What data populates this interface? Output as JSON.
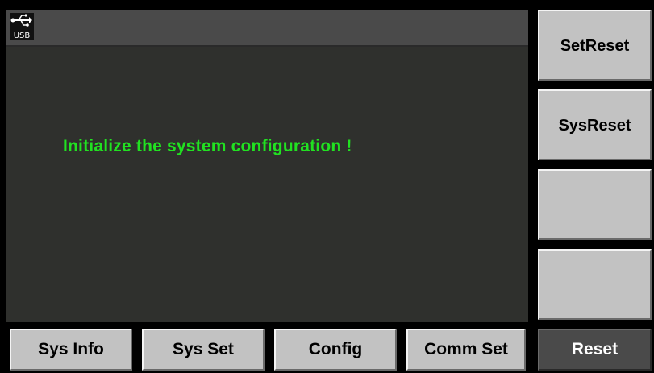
{
  "status_bar": {
    "usb_icon": "usb-icon",
    "usb_label": "USB"
  },
  "main": {
    "message": "Initialize the system configuration !",
    "message_color": "#21e221"
  },
  "side_menu": {
    "items": [
      {
        "label": "SetReset"
      },
      {
        "label": "SysReset"
      },
      {
        "label": ""
      },
      {
        "label": ""
      }
    ]
  },
  "bottom_menu": {
    "items": [
      {
        "label": "Sys Info"
      },
      {
        "label": "Sys Set"
      },
      {
        "label": "Config"
      },
      {
        "label": "Comm Set"
      },
      {
        "label": "Reset",
        "active": true
      }
    ]
  }
}
